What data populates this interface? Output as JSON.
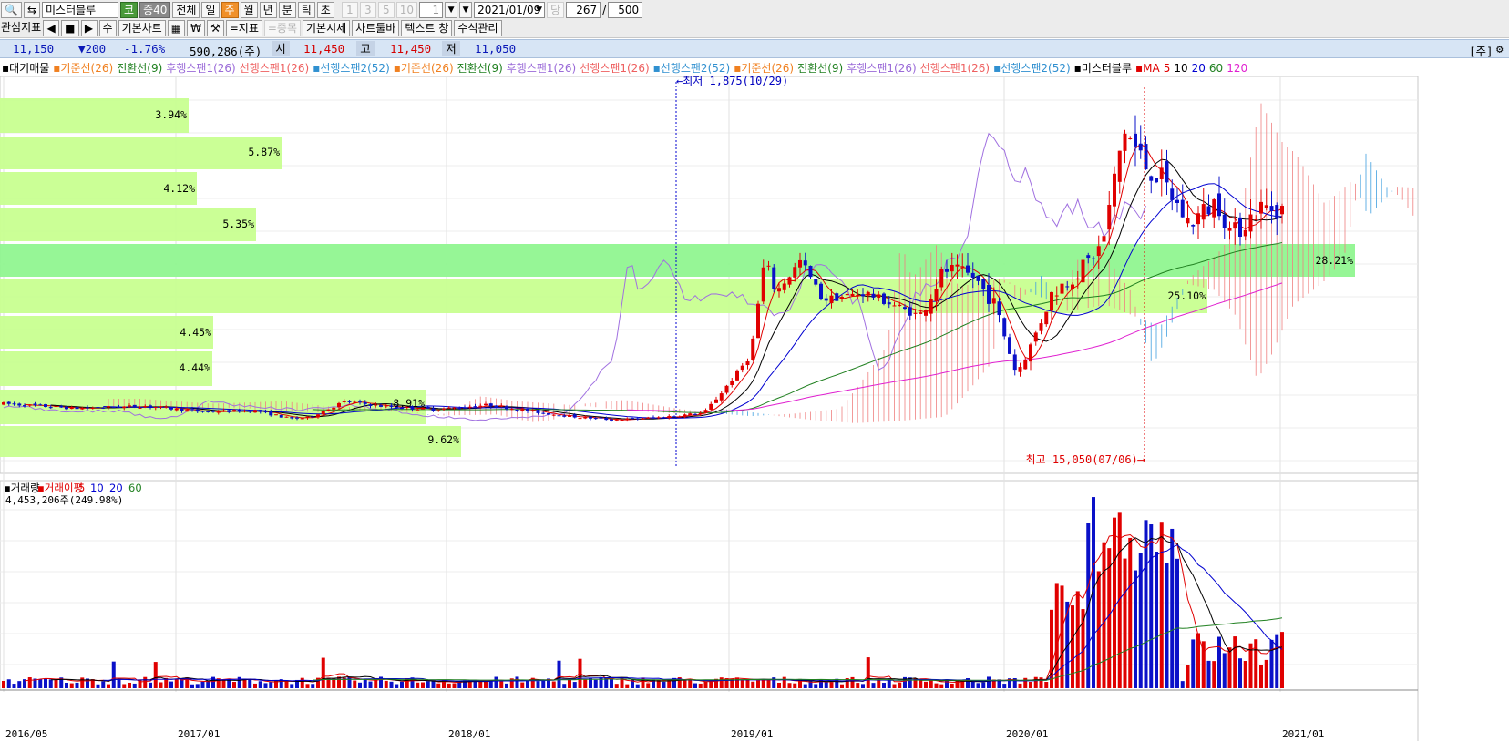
{
  "toolbar": {
    "stock_name": "미스터블루",
    "market_badge": "코",
    "margin_badge": "증40",
    "periods": [
      "전체",
      "일",
      "주",
      "월",
      "년",
      "분",
      "틱",
      "초"
    ],
    "selected_period": "주",
    "interval_buttons": [
      "1",
      "3",
      "5",
      "10"
    ],
    "interval_value": "1",
    "date": "2021/01/09",
    "count_label": "당",
    "count_value": "267",
    "count_slash": "/",
    "count_total": "500"
  },
  "toolbar2": {
    "interest_indicators": "관심지표",
    "basic_chart": "기본차트",
    "indicator": "=지표",
    "item": "=종목",
    "basic_quote": "기본시세",
    "chart_toolbar": "차트툴바",
    "text_window": "텍스트 창",
    "formula_manager": "수식관리"
  },
  "pricebar": {
    "price": "11,150",
    "change": "▼200",
    "change_pct": "-1.76%",
    "volume": "590,286(주)",
    "open_label": "시",
    "open": "11,450",
    "high_label": "고",
    "high": "11,450",
    "low_label": "저",
    "low": "11,050",
    "unit": "[주]"
  },
  "legend": [
    {
      "text": "▪대기매물",
      "color": "#000000"
    },
    {
      "text": "▪기준선(26)",
      "color": "#f08020"
    },
    {
      "text": "전환선(9)",
      "color": "#208020"
    },
    {
      "text": "후행스팬1(26)",
      "color": "#9a6ad8"
    },
    {
      "text": "선행스팬1(26)",
      "color": "#ee6060"
    },
    {
      "text": "▪선행스팬2(52)",
      "color": "#3090d0"
    },
    {
      "text": "▪기준선(26)",
      "color": "#f08020"
    },
    {
      "text": "전환선(9)",
      "color": "#208020"
    },
    {
      "text": "후행스팬1(26)",
      "color": "#9a6ad8"
    },
    {
      "text": "선행스팬1(26)",
      "color": "#ee6060"
    },
    {
      "text": "▪선행스팬2(52)",
      "color": "#3090d0"
    },
    {
      "text": "▪기준선(26)",
      "color": "#f08020"
    },
    {
      "text": "전환선(9)",
      "color": "#208020"
    },
    {
      "text": "후행스팬1(26)",
      "color": "#9a6ad8"
    },
    {
      "text": "선행스팬1(26)",
      "color": "#ee6060"
    },
    {
      "text": "▪선행스팬2(52)",
      "color": "#3090d0"
    },
    {
      "text": "▪미스터블루",
      "color": "#000000"
    },
    {
      "text": "▪MA",
      "color": "#e00000"
    },
    {
      "text": "5",
      "color": "#e00000"
    },
    {
      "text": "10",
      "color": "#000000"
    },
    {
      "text": "20",
      "color": "#0000d0"
    },
    {
      "text": "60",
      "color": "#208020"
    },
    {
      "text": "120",
      "color": "#e020d0"
    }
  ],
  "volume_legend": [
    {
      "text": "▪거래량",
      "color": "#000000"
    },
    {
      "text": "▪거래이평",
      "color": "#e00000"
    },
    {
      "text": "5",
      "color": "#e00000"
    },
    {
      "text": "10",
      "color": "#0000d0"
    },
    {
      "text": "20",
      "color": "#0000d0"
    },
    {
      "text": "60",
      "color": "#208020"
    }
  ],
  "volume_value": "4,453,206주(249.98%)",
  "annotations": {
    "low_marker": "←최저 1,875(10/29)",
    "high_marker": "최고 15,050(07/06)⟶"
  },
  "supply_bars": [
    {
      "pct": "3.94%",
      "color": "#c8ff90"
    },
    {
      "pct": "5.87%",
      "color": "#c8ff90"
    },
    {
      "pct": "4.12%",
      "color": "#c8ff90"
    },
    {
      "pct": "5.35%",
      "color": "#c8ff90"
    },
    {
      "pct": "28.21%",
      "color": "#90f590"
    },
    {
      "pct": "25.10%",
      "color": "#c8ff90"
    },
    {
      "pct": "4.45%",
      "color": "#c8ff90"
    },
    {
      "pct": "4.44%",
      "color": "#c8ff90"
    },
    {
      "pct": "8.91%",
      "color": "#c8ff90"
    },
    {
      "pct": "9.62%",
      "color": "#c8ff90"
    }
  ],
  "x_axis": [
    "2016/05",
    "2017/01",
    "2018/01",
    "2019/01",
    "2020/01",
    "2021/01"
  ],
  "colors": {
    "up": "#e00000",
    "down": "#0a10c8",
    "cloud_up": "#f08080",
    "cloud_down": "#40a0e0"
  },
  "chart_data": {
    "type": "candlestick",
    "period": "weekly",
    "x_start": "2016/05",
    "x_end": "2021/01",
    "all_time_low": {
      "price": 1875,
      "date": "10/29"
    },
    "all_time_high": {
      "price": 15050,
      "date": "07/06"
    },
    "last": {
      "open": 11450,
      "high": 11450,
      "low": 11050,
      "close": 11150
    },
    "volume_profile_pct": [
      3.94,
      5.87,
      4.12,
      5.35,
      28.21,
      25.1,
      4.45,
      4.44,
      8.91,
      9.62
    ]
  }
}
